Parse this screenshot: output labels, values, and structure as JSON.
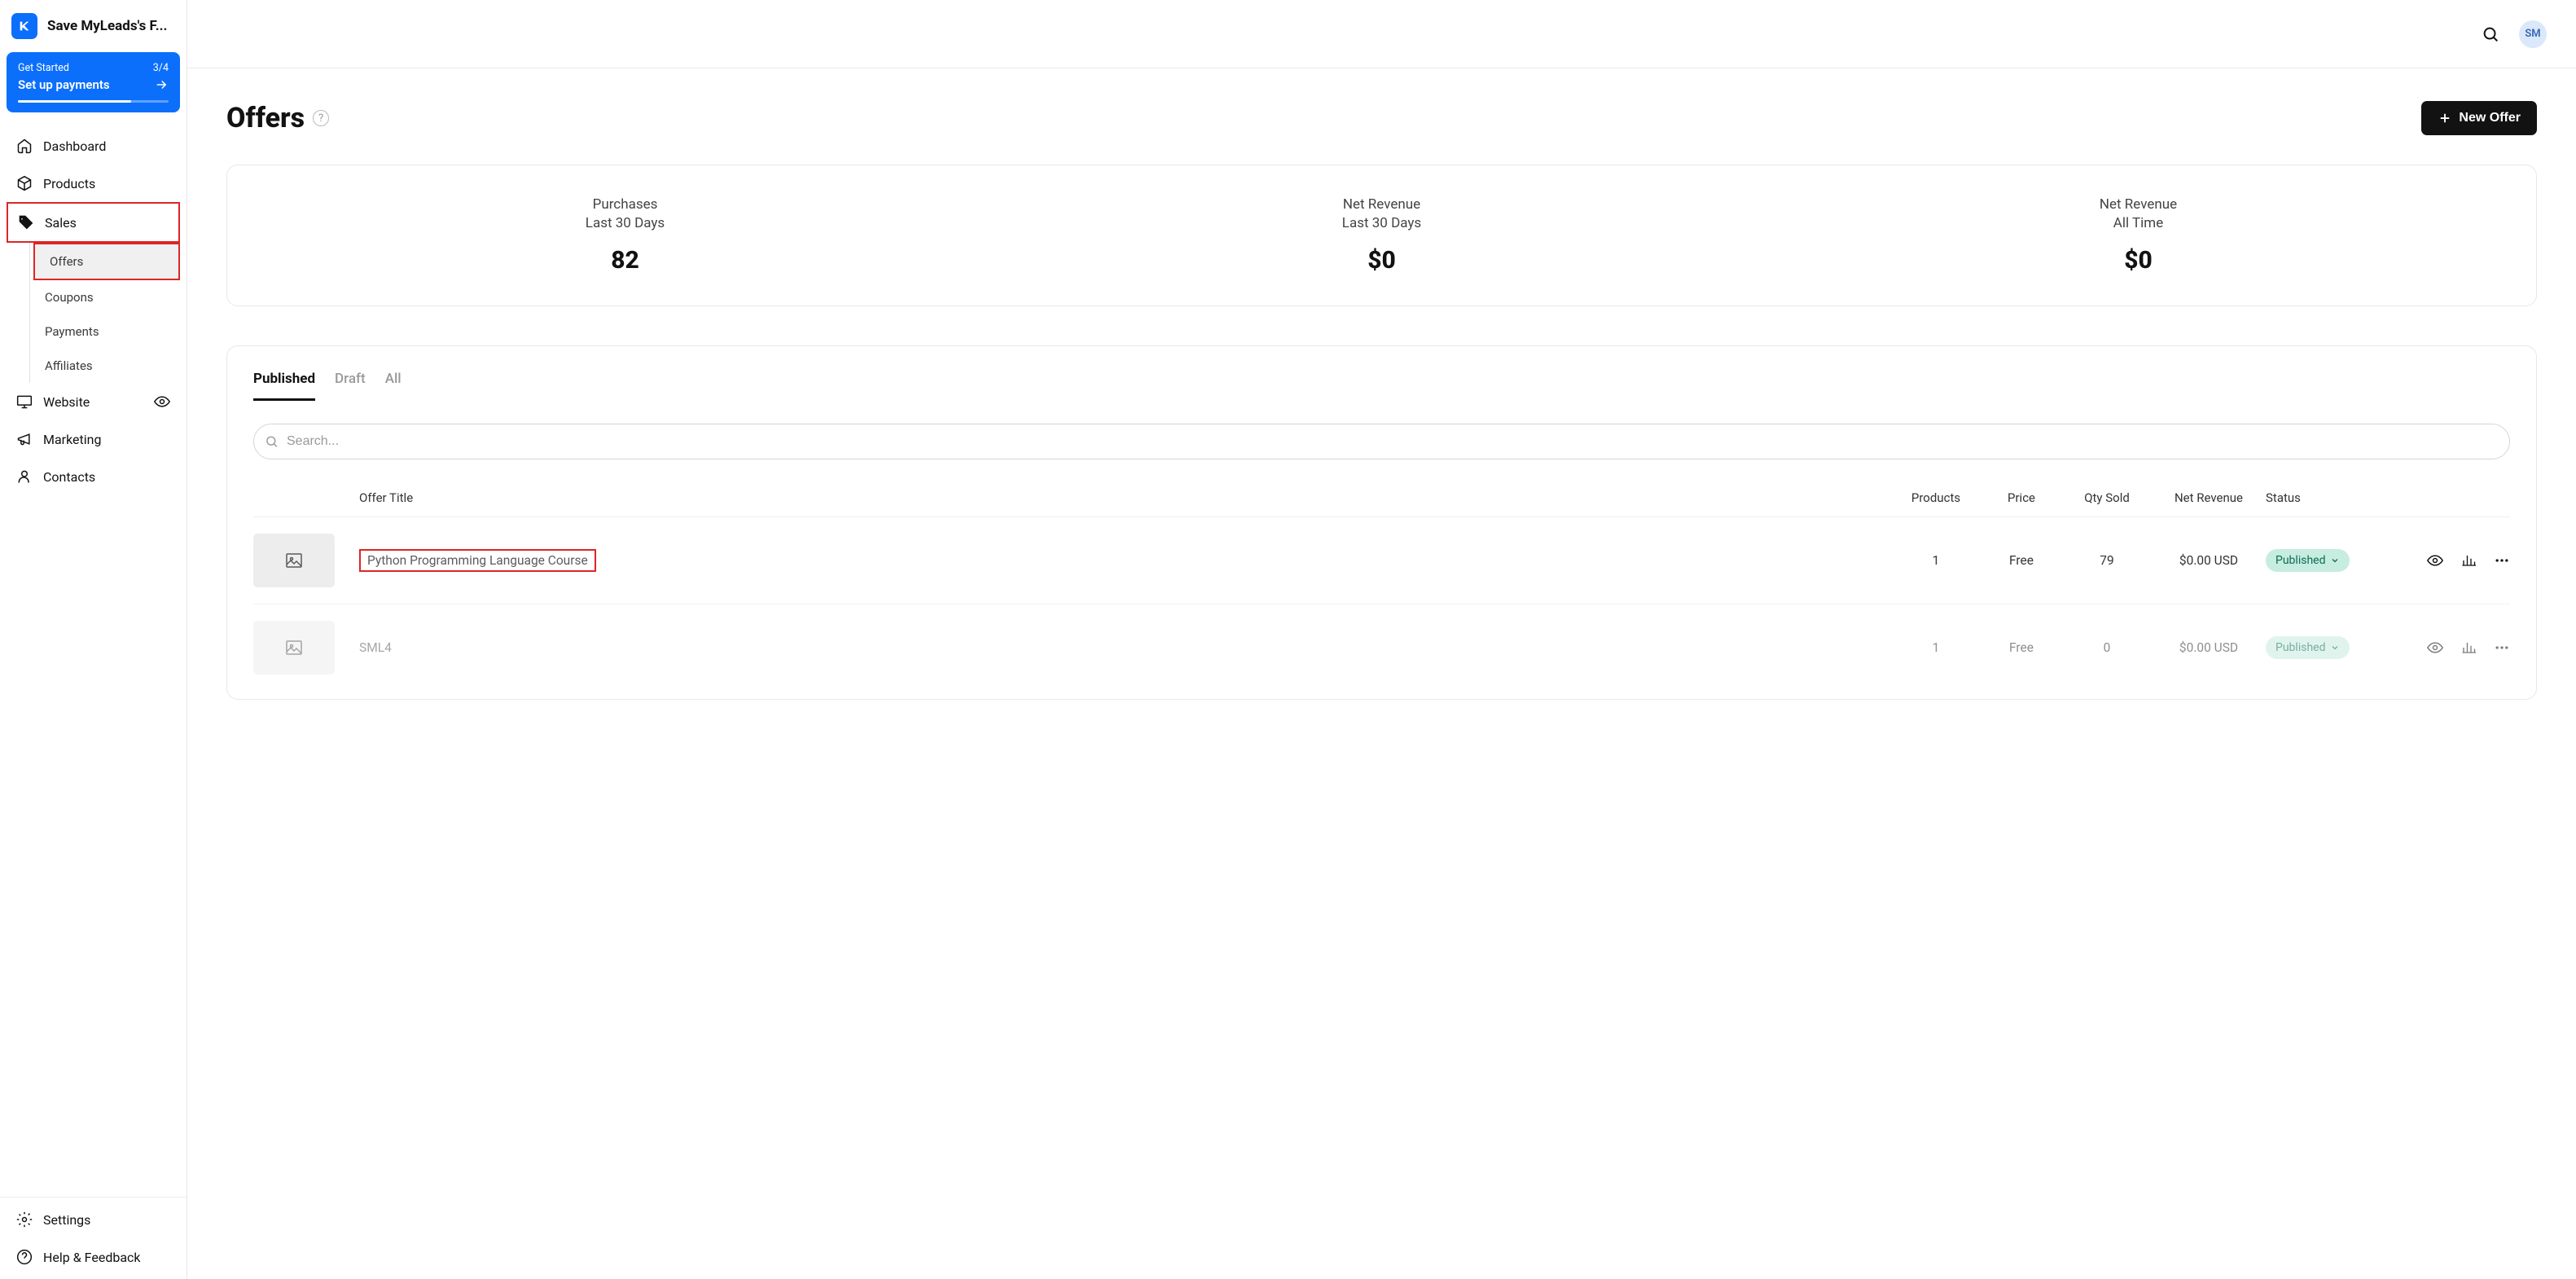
{
  "workspace": {
    "name": "Save MyLeads's F..."
  },
  "get_started": {
    "label": "Get Started",
    "progress": "3/4",
    "title": "Set up payments"
  },
  "sidebar": {
    "items": [
      {
        "label": "Dashboard"
      },
      {
        "label": "Products"
      },
      {
        "label": "Sales"
      },
      {
        "label": "Website"
      },
      {
        "label": "Marketing"
      },
      {
        "label": "Contacts"
      }
    ],
    "sales_sub": [
      {
        "label": "Offers"
      },
      {
        "label": "Coupons"
      },
      {
        "label": "Payments"
      },
      {
        "label": "Affiliates"
      }
    ],
    "footer": [
      {
        "label": "Settings"
      },
      {
        "label": "Help & Feedback"
      }
    ]
  },
  "topbar": {
    "avatar_initials": "SM"
  },
  "page": {
    "title": "Offers",
    "new_button": "New Offer"
  },
  "stats": [
    {
      "label": "Purchases",
      "sublabel": "Last 30 Days",
      "value": "82"
    },
    {
      "label": "Net Revenue",
      "sublabel": "Last 30 Days",
      "value": "$0"
    },
    {
      "label": "Net Revenue",
      "sublabel": "All Time",
      "value": "$0"
    }
  ],
  "tabs": [
    {
      "label": "Published"
    },
    {
      "label": "Draft"
    },
    {
      "label": "All"
    }
  ],
  "search": {
    "placeholder": "Search..."
  },
  "table": {
    "headers": {
      "title": "Offer Title",
      "products": "Products",
      "price": "Price",
      "qty": "Qty Sold",
      "revenue": "Net Revenue",
      "status": "Status"
    },
    "rows": [
      {
        "title": "Python Programming Language Course",
        "products": "1",
        "price": "Free",
        "qty": "79",
        "revenue": "$0.00 USD",
        "status": "Published"
      },
      {
        "title": "SML4",
        "products": "1",
        "price": "Free",
        "qty": "0",
        "revenue": "$0.00 USD",
        "status": "Published"
      }
    ]
  }
}
